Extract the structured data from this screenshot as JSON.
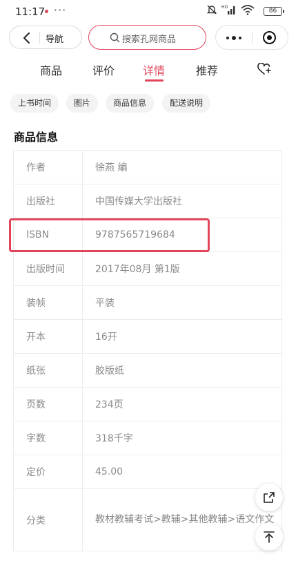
{
  "status_bar": {
    "time": "11:17",
    "more": "···",
    "battery": "86"
  },
  "top_bar": {
    "back_label": "导航",
    "search_placeholder": "搜索孔网商品"
  },
  "tabs": [
    {
      "label": "商品",
      "active": false
    },
    {
      "label": "评价",
      "active": false
    },
    {
      "label": "详情",
      "active": true
    },
    {
      "label": "推荐",
      "active": false
    }
  ],
  "chips": [
    "上书时间",
    "图片",
    "商品信息",
    "配送说明"
  ],
  "section_title": "商品信息",
  "info_rows": [
    {
      "key": "作者",
      "value": "徐燕 编"
    },
    {
      "key": "出版社",
      "value": "中国传媒大学出版社"
    },
    {
      "key": "ISBN",
      "value": "9787565719684"
    },
    {
      "key": "出版时间",
      "value": "2017年08月 第1版"
    },
    {
      "key": "装帧",
      "value": "平装"
    },
    {
      "key": "开本",
      "value": "16开"
    },
    {
      "key": "纸张",
      "value": "胶版纸"
    },
    {
      "key": "页数",
      "value": "234页"
    },
    {
      "key": "字数",
      "value": "318千字"
    },
    {
      "key": "定价",
      "value": "45.00"
    },
    {
      "key": "分类",
      "value": "教材教辅考试>教辅>其他教辅>语文作文"
    }
  ],
  "colors": {
    "accent": "#e0455a",
    "muted_text": "#8a8a8a",
    "chip_bg": "#f3f3f3"
  },
  "icons": [
    "back-chevron-icon",
    "search-icon",
    "more-dots-icon",
    "target-icon",
    "heart-plus-icon",
    "share-icon",
    "back-to-top-icon",
    "mute-icon",
    "signal-icon",
    "wifi-icon",
    "battery-icon"
  ]
}
